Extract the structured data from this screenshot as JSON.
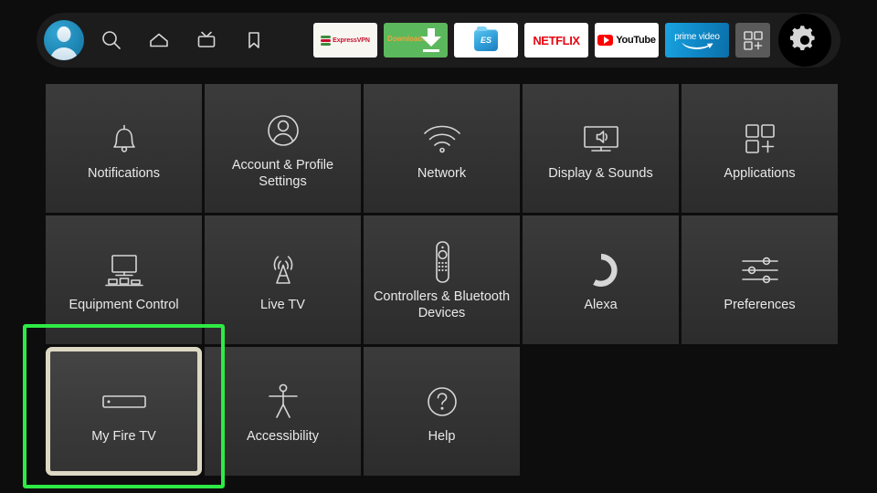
{
  "screen": {
    "name": "Fire TV Settings",
    "background_color": "#0d0d0d",
    "tile_color": "#363636",
    "focus_color": "#2eea45",
    "selection_color": "#ddd8c4"
  },
  "topbar": {
    "profile": {
      "name": "profile-avatar",
      "label": "Profile"
    },
    "nav_items": [
      {
        "icon": "search-icon",
        "label": "Search"
      },
      {
        "icon": "home-icon",
        "label": "Home"
      },
      {
        "icon": "live-tv-icon",
        "label": "Live"
      },
      {
        "icon": "bookmark-icon",
        "label": "Watchlist"
      }
    ],
    "apps": [
      {
        "name": "ExpressVPN",
        "key": "expressvpn"
      },
      {
        "name": "Downloader",
        "key": "downloader"
      },
      {
        "name": "ES File Explorer",
        "key": "esfile"
      },
      {
        "name": "NETFLIX",
        "key": "netflix"
      },
      {
        "name": "YouTube",
        "key": "youtube"
      },
      {
        "name": "prime video",
        "key": "prime"
      }
    ],
    "apps_grid_label": "Apps",
    "settings_label": "Settings",
    "settings_selected": true
  },
  "settings": {
    "tiles": [
      {
        "label": "Notifications",
        "icon": "bell-icon",
        "focused": false
      },
      {
        "label": "Account & Profile Settings",
        "icon": "person-circle-icon",
        "focused": false
      },
      {
        "label": "Network",
        "icon": "wifi-icon",
        "focused": false
      },
      {
        "label": "Display & Sounds",
        "icon": "tv-speaker-icon",
        "focused": false
      },
      {
        "label": "Applications",
        "icon": "apps-grid-plus-icon",
        "focused": false
      },
      {
        "label": "Equipment Control",
        "icon": "equipment-tv-icon",
        "focused": false
      },
      {
        "label": "Live TV",
        "icon": "antenna-tower-icon",
        "focused": false
      },
      {
        "label": "Controllers & Bluetooth Devices",
        "icon": "remote-control-icon",
        "focused": false
      },
      {
        "label": "Alexa",
        "icon": "alexa-ring-icon",
        "focused": false
      },
      {
        "label": "Preferences",
        "icon": "sliders-icon",
        "focused": false
      },
      {
        "label": "My Fire TV",
        "icon": "fire-tv-stick-icon",
        "focused": true
      },
      {
        "label": "Accessibility",
        "icon": "accessibility-person-icon",
        "focused": false
      },
      {
        "label": "Help",
        "icon": "question-circle-icon",
        "focused": false
      }
    ]
  }
}
